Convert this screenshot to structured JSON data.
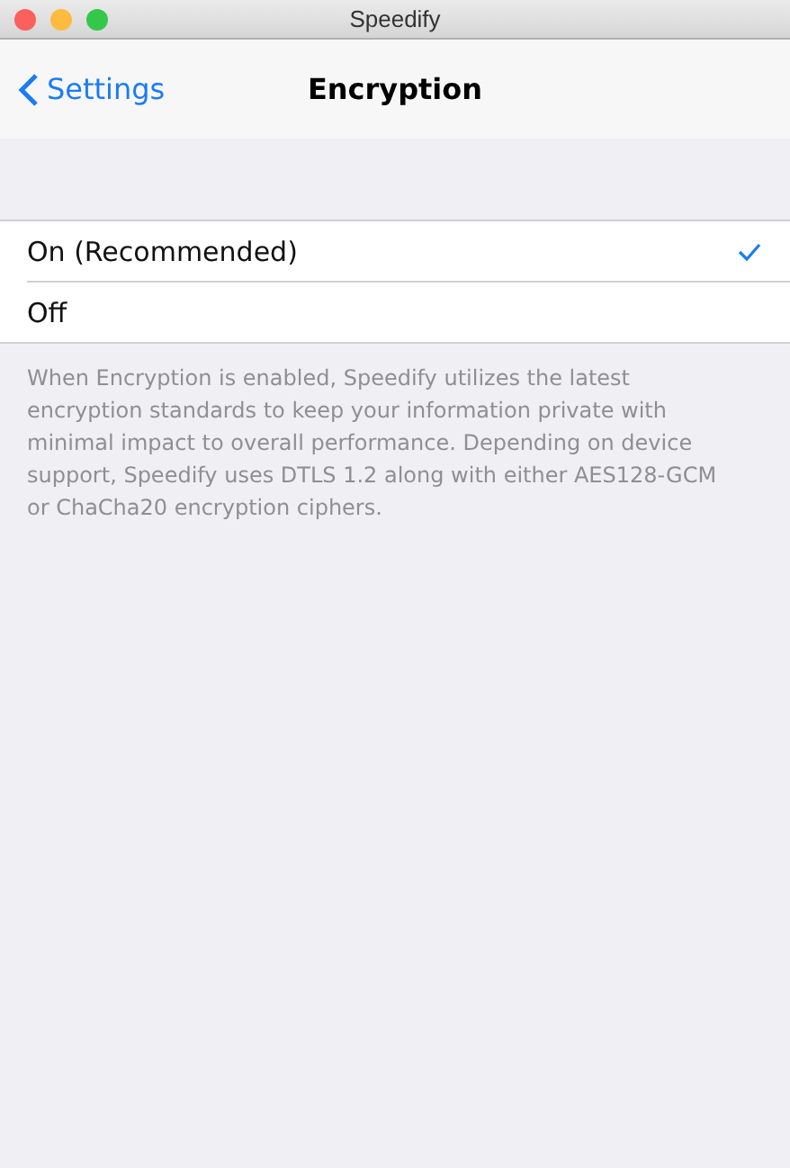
{
  "window": {
    "title": "Speedify"
  },
  "nav": {
    "back": "Settings",
    "title": "Encryption"
  },
  "options": [
    {
      "label": "On (Recommended)",
      "selected": true
    },
    {
      "label": "Off",
      "selected": false
    }
  ],
  "footer": "When Encryption is enabled, Speedify utilizes the latest encryption standards to keep your information private with minimal impact to overall performance. Depending on device support, Speedify uses DTLS 1.2 along with either AES128-GCM or ChaCha20 encryption ciphers."
}
